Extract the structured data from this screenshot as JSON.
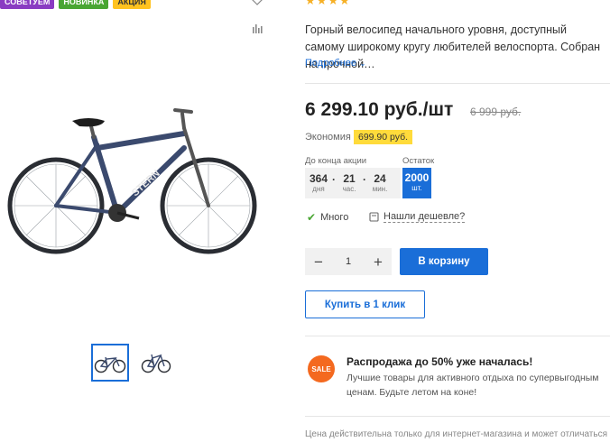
{
  "badges": [
    "Советуем",
    "Новинка",
    "Акция"
  ],
  "description": "Горный велосипед начального уровня, доступный самому широкому кругу любителей велоспорта. Собран на прочной…",
  "more_link": "Подробнее",
  "price": "6 299.10 руб./шт",
  "old_price": "6 999 руб.",
  "economy": {
    "label": "Экономия",
    "value": "699.90 руб."
  },
  "timer": {
    "label": "До конца акции",
    "days": "364",
    "days_unit": "дня",
    "hours": "21",
    "hours_unit": "час.",
    "minutes": "24",
    "minutes_unit": "мин."
  },
  "stock": {
    "label": "Остаток",
    "value": "2000",
    "unit": "шт."
  },
  "availability": "Много",
  "cheaper_link": "Нашли дешевле?",
  "quantity": {
    "value": "1",
    "minus": "−",
    "plus": "+"
  },
  "cart_button": "В корзину",
  "oneclick_button": "Купить в 1 клик",
  "promo": {
    "badge": "SALE",
    "title": "Распродажа до 50% уже началась!",
    "text": "Лучшие товары для активного отдыха по супервыгодным ценам. Будьте летом на коне!"
  },
  "disclaimer": "Цена действительна только для интернет-магазина и может отличаться",
  "colors": {
    "accent": "#1a6ed8",
    "star": "#f6b026",
    "sale": "#f4691f",
    "highlight": "#ffdb3b"
  },
  "icons": [
    "heart-icon",
    "compare-icon",
    "check-icon",
    "price-tag-icon",
    "chevron-down-icon"
  ]
}
